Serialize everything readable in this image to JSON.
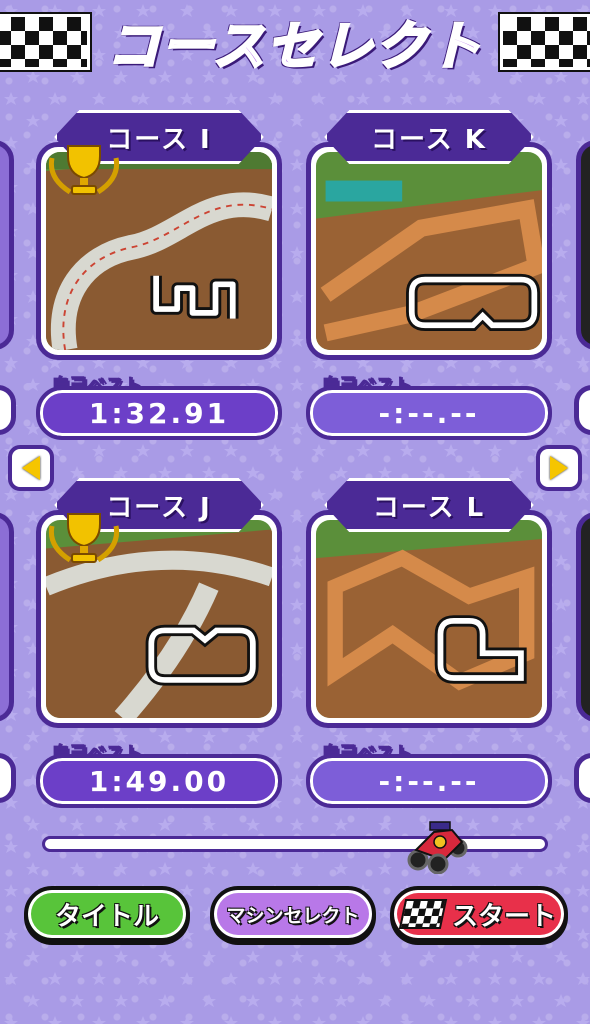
{
  "screen": {
    "title": "コースセレクト"
  },
  "courses": [
    {
      "name": "コース I",
      "best_label": "自己ベスト",
      "best_time": "1:32.91",
      "has_trophy": true
    },
    {
      "name": "コース K",
      "best_label": "自己ベスト",
      "best_time": "-:--.--",
      "has_trophy": false
    },
    {
      "name": "コース J",
      "best_label": "自己ベスト",
      "best_time": "1:49.00",
      "has_trophy": true
    },
    {
      "name": "コース L",
      "best_label": "自己ベスト",
      "best_time": "-:--.--",
      "has_trophy": false
    }
  ],
  "navigation": {
    "prev_icon": "arrow-left-icon",
    "next_icon": "arrow-right-icon"
  },
  "progress": {
    "fraction": 0.82
  },
  "buttons": {
    "title_label": "タイトル",
    "machine_label": "マシンセレクト",
    "start_label": "スタート"
  },
  "colors": {
    "background": "#a99be6",
    "frame": "#4b2a96",
    "title": "#b26ae8",
    "title_button": "#58c43a",
    "machine_button": "#b878e8",
    "start_button": "#e8304a",
    "arrow": "#f5c500"
  }
}
